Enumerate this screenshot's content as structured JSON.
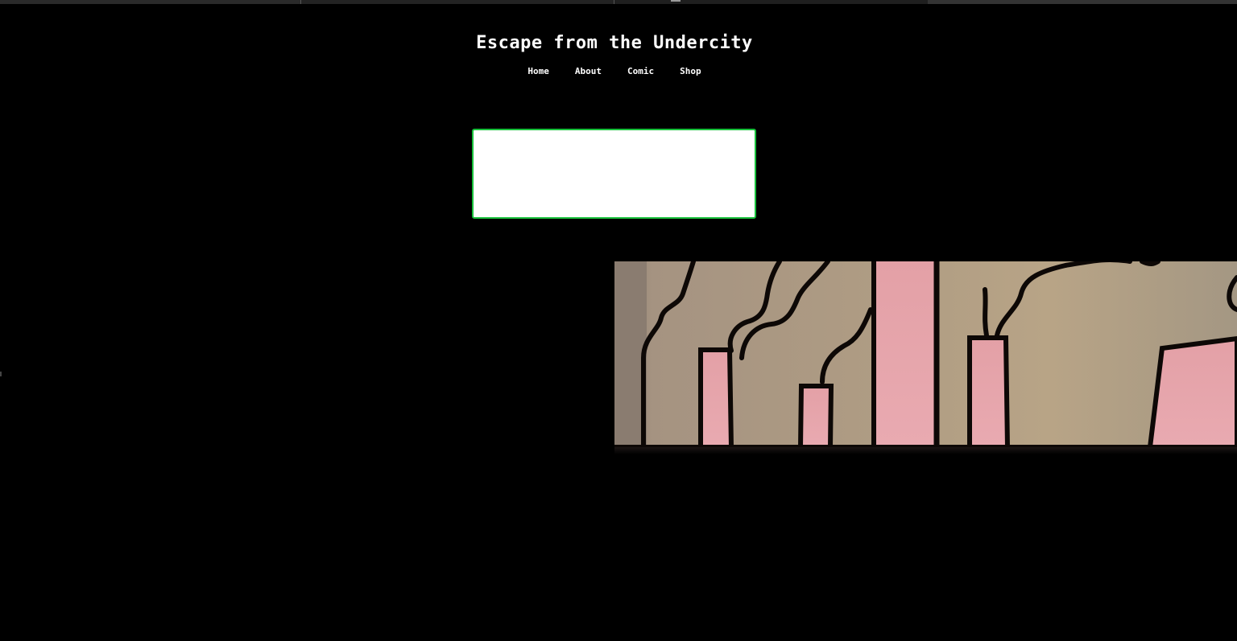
{
  "site": {
    "title": "Escape from the Undercity"
  },
  "nav": {
    "items": [
      {
        "label": "Home"
      },
      {
        "label": "About"
      },
      {
        "label": "Comic"
      },
      {
        "label": "Shop"
      }
    ]
  },
  "colors": {
    "background": "#000000",
    "title_text": "#ffffff",
    "box_border": "#19c13c",
    "box_fill": "#ffffff",
    "panel_bg": "#a89680",
    "chimney_pink": "#e8a3ab",
    "ink": "#0d0806"
  },
  "comic": {
    "image_name": "comic-panel-chimneys"
  }
}
